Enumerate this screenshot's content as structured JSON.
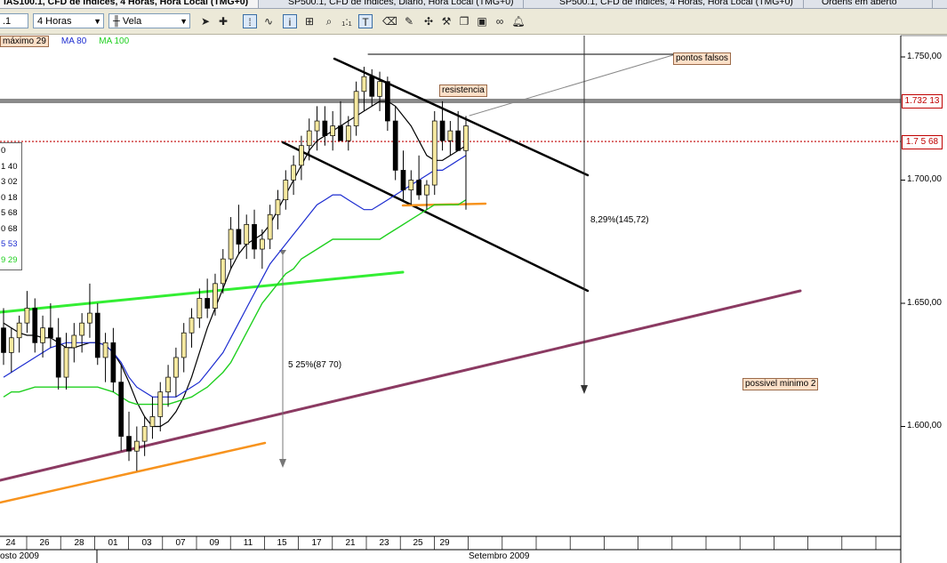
{
  "tabs": [
    {
      "label": "IAS100.1, CFD de Índices, 4 Horas, Hora Local (TMG+0)",
      "active": true
    },
    {
      "label": "SP500.1, CFD de Índices, Diário, Hora Local (TMG+0)",
      "active": false
    },
    {
      "label": "SP500.1, CFD de Índices, 4 Horas, Hora Local (TMG+0)",
      "active": false
    },
    {
      "label": "Ordens em aberto",
      "active": false
    }
  ],
  "toolbar": {
    "symbol_value": ".1",
    "period_value": "4 Horas",
    "chart_type_value": "Vela"
  },
  "legend": {
    "marker": "máximo 29",
    "ma80": "MA 80",
    "ma100": "MA 100",
    "colors": {
      "ma20": "#000000",
      "ma80": "#1c2cd0",
      "ma100": "#20d020"
    }
  },
  "ohlc_panel": [
    "0",
    "1 40",
    "3 02",
    "0 18",
    "5 68",
    "0 68",
    "5 53",
    "9 29"
  ],
  "annotations": {
    "pontos_falsos": "pontos falsos",
    "resistencia": "resistencia",
    "measure_right": "8,29%(145,72)",
    "measure_left": "5 25%(87 70)",
    "possivel_minimo": "possivel minimo 2"
  },
  "chart_data": {
    "type": "candlestick",
    "title": "",
    "xlabel": "",
    "ylabel": "",
    "y_axis_ticks": [
      "1.750,00",
      "1.700,00",
      "1.650,00",
      "1.600,00"
    ],
    "ylim": [
      1570,
      1780
    ],
    "price_boxes": [
      {
        "label": "1.732 13",
        "value": 1732.13,
        "color": "#c00000"
      },
      {
        "label": "1.7 5 68",
        "value": 1715.68,
        "color": "#c00000"
      }
    ],
    "x_tick_labels": [
      "24",
      "26",
      "28",
      "01",
      "03",
      "07",
      "09",
      "11",
      "15",
      "17",
      "21",
      "23",
      "25",
      "29"
    ],
    "month_labels": [
      "osto 2009",
      "Setembro 2009"
    ],
    "series": [
      {
        "name": "MA 80",
        "color": "#1c2cd0"
      },
      {
        "name": "MA 100",
        "color": "#20d020"
      }
    ],
    "candles": [
      {
        "o": 1640,
        "h": 1648,
        "l": 1625,
        "c": 1630
      },
      {
        "o": 1630,
        "h": 1640,
        "l": 1622,
        "c": 1636
      },
      {
        "o": 1636,
        "h": 1645,
        "l": 1630,
        "c": 1642
      },
      {
        "o": 1642,
        "h": 1655,
        "l": 1638,
        "c": 1648
      },
      {
        "o": 1648,
        "h": 1652,
        "l": 1630,
        "c": 1634
      },
      {
        "o": 1634,
        "h": 1645,
        "l": 1628,
        "c": 1640
      },
      {
        "o": 1640,
        "h": 1650,
        "l": 1632,
        "c": 1636
      },
      {
        "o": 1636,
        "h": 1644,
        "l": 1615,
        "c": 1620
      },
      {
        "o": 1620,
        "h": 1638,
        "l": 1615,
        "c": 1632
      },
      {
        "o": 1632,
        "h": 1642,
        "l": 1626,
        "c": 1637
      },
      {
        "o": 1637,
        "h": 1646,
        "l": 1630,
        "c": 1642
      },
      {
        "o": 1642,
        "h": 1658,
        "l": 1636,
        "c": 1646
      },
      {
        "o": 1646,
        "h": 1650,
        "l": 1625,
        "c": 1628
      },
      {
        "o": 1628,
        "h": 1638,
        "l": 1618,
        "c": 1634
      },
      {
        "o": 1634,
        "h": 1640,
        "l": 1614,
        "c": 1618
      },
      {
        "o": 1618,
        "h": 1625,
        "l": 1590,
        "c": 1596
      },
      {
        "o": 1596,
        "h": 1606,
        "l": 1586,
        "c": 1590
      },
      {
        "o": 1590,
        "h": 1600,
        "l": 1582,
        "c": 1594
      },
      {
        "o": 1594,
        "h": 1604,
        "l": 1588,
        "c": 1600
      },
      {
        "o": 1600,
        "h": 1612,
        "l": 1595,
        "c": 1604
      },
      {
        "o": 1604,
        "h": 1618,
        "l": 1598,
        "c": 1614
      },
      {
        "o": 1614,
        "h": 1625,
        "l": 1608,
        "c": 1620
      },
      {
        "o": 1620,
        "h": 1632,
        "l": 1612,
        "c": 1628
      },
      {
        "o": 1628,
        "h": 1642,
        "l": 1622,
        "c": 1638
      },
      {
        "o": 1638,
        "h": 1648,
        "l": 1632,
        "c": 1644
      },
      {
        "o": 1644,
        "h": 1656,
        "l": 1640,
        "c": 1652
      },
      {
        "o": 1652,
        "h": 1660,
        "l": 1644,
        "c": 1648
      },
      {
        "o": 1648,
        "h": 1662,
        "l": 1645,
        "c": 1658
      },
      {
        "o": 1658,
        "h": 1672,
        "l": 1654,
        "c": 1668
      },
      {
        "o": 1668,
        "h": 1685,
        "l": 1664,
        "c": 1680
      },
      {
        "o": 1680,
        "h": 1690,
        "l": 1670,
        "c": 1674
      },
      {
        "o": 1674,
        "h": 1686,
        "l": 1668,
        "c": 1682
      },
      {
        "o": 1682,
        "h": 1688,
        "l": 1668,
        "c": 1672
      },
      {
        "o": 1672,
        "h": 1680,
        "l": 1664,
        "c": 1676
      },
      {
        "o": 1676,
        "h": 1690,
        "l": 1672,
        "c": 1686
      },
      {
        "o": 1686,
        "h": 1696,
        "l": 1680,
        "c": 1692
      },
      {
        "o": 1692,
        "h": 1704,
        "l": 1688,
        "c": 1700
      },
      {
        "o": 1700,
        "h": 1710,
        "l": 1694,
        "c": 1706
      },
      {
        "o": 1706,
        "h": 1718,
        "l": 1700,
        "c": 1714
      },
      {
        "o": 1714,
        "h": 1725,
        "l": 1708,
        "c": 1720
      },
      {
        "o": 1720,
        "h": 1730,
        "l": 1712,
        "c": 1724
      },
      {
        "o": 1724,
        "h": 1730,
        "l": 1714,
        "c": 1718
      },
      {
        "o": 1718,
        "h": 1728,
        "l": 1712,
        "c": 1722
      },
      {
        "o": 1722,
        "h": 1732,
        "l": 1716,
        "c": 1716
      },
      {
        "o": 1716,
        "h": 1726,
        "l": 1712,
        "c": 1722
      },
      {
        "o": 1722,
        "h": 1740,
        "l": 1718,
        "c": 1736
      },
      {
        "o": 1736,
        "h": 1746,
        "l": 1728,
        "c": 1742
      },
      {
        "o": 1742,
        "h": 1745,
        "l": 1730,
        "c": 1734
      },
      {
        "o": 1734,
        "h": 1744,
        "l": 1728,
        "c": 1740
      },
      {
        "o": 1740,
        "h": 1742,
        "l": 1720,
        "c": 1724
      },
      {
        "o": 1724,
        "h": 1730,
        "l": 1700,
        "c": 1704
      },
      {
        "o": 1704,
        "h": 1712,
        "l": 1692,
        "c": 1696
      },
      {
        "o": 1696,
        "h": 1704,
        "l": 1690,
        "c": 1700
      },
      {
        "o": 1700,
        "h": 1710,
        "l": 1692,
        "c": 1694
      },
      {
        "o": 1694,
        "h": 1700,
        "l": 1688,
        "c": 1698
      },
      {
        "o": 1698,
        "h": 1728,
        "l": 1694,
        "c": 1724
      },
      {
        "o": 1724,
        "h": 1732,
        "l": 1712,
        "c": 1716
      },
      {
        "o": 1716,
        "h": 1724,
        "l": 1710,
        "c": 1720
      },
      {
        "o": 1720,
        "h": 1728,
        "l": 1714,
        "c": 1712
      },
      {
        "o": 1712,
        "h": 1726,
        "l": 1688,
        "c": 1722
      }
    ],
    "moving_averages": {
      "ma20": [
        1642,
        1640,
        1638,
        1637,
        1637,
        1636,
        1636,
        1634,
        1632,
        1632,
        1633,
        1634,
        1634,
        1633,
        1630,
        1625,
        1618,
        1610,
        1604,
        1600,
        1600,
        1602,
        1606,
        1612,
        1620,
        1630,
        1640,
        1648,
        1656,
        1664,
        1670,
        1674,
        1676,
        1678,
        1682,
        1688,
        1694,
        1700,
        1706,
        1712,
        1716,
        1718,
        1720,
        1722,
        1724,
        1726,
        1728,
        1730,
        1732,
        1732,
        1730,
        1726,
        1722,
        1716,
        1710,
        1708,
        1708,
        1710,
        1712,
        1714
      ],
      "ma80": [
        1620,
        1622,
        1624,
        1626,
        1628,
        1630,
        1632,
        1633,
        1634,
        1634,
        1634,
        1634,
        1634,
        1633,
        1630,
        1626,
        1620,
        1616,
        1614,
        1612,
        1612,
        1612,
        1612,
        1614,
        1616,
        1618,
        1622,
        1626,
        1630,
        1636,
        1642,
        1648,
        1654,
        1660,
        1666,
        1670,
        1674,
        1678,
        1682,
        1686,
        1690,
        1692,
        1694,
        1694,
        1692,
        1690,
        1688,
        1688,
        1690,
        1692,
        1694,
        1696,
        1698,
        1700,
        1702,
        1704,
        1704,
        1706,
        1708,
        1710
      ],
      "ma100": [
        1612,
        1614,
        1614,
        1615,
        1616,
        1616,
        1616,
        1616,
        1616,
        1616,
        1616,
        1616,
        1616,
        1615,
        1614,
        1612,
        1610,
        1609,
        1609,
        1609,
        1609,
        1609,
        1610,
        1611,
        1612,
        1614,
        1616,
        1619,
        1622,
        1626,
        1632,
        1638,
        1644,
        1650,
        1654,
        1658,
        1662,
        1664,
        1668,
        1670,
        1672,
        1674,
        1676,
        1676,
        1676,
        1676,
        1676,
        1676,
        1676,
        1678,
        1680,
        1682,
        1684,
        1686,
        1688,
        1690,
        1690,
        1690,
        1690,
        1692
      ]
    }
  }
}
